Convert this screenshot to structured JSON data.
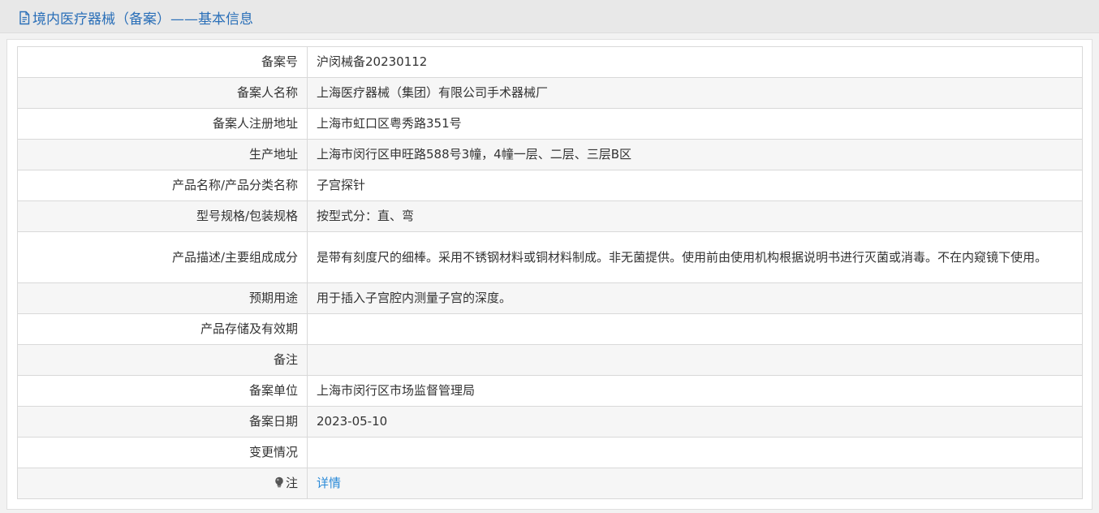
{
  "header": {
    "title": "境内医疗器械（备案）——基本信息",
    "icon": "document-icon"
  },
  "rows": [
    {
      "label": "备案号",
      "value": "沪闵械备20230112"
    },
    {
      "label": "备案人名称",
      "value": "上海医疗器械（集团）有限公司手术器械厂"
    },
    {
      "label": "备案人注册地址",
      "value": "上海市虹口区粤秀路351号"
    },
    {
      "label": "生产地址",
      "value": "上海市闵行区申旺路588号3幢，4幢一层、二层、三层B区"
    },
    {
      "label": "产品名称/产品分类名称",
      "value": "子宫探针"
    },
    {
      "label": "型号规格/包装规格",
      "value": "按型式分：直、弯"
    },
    {
      "label": "产品描述/主要组成成分",
      "value": "是带有刻度尺的细棒。采用不锈钢材料或铜材料制成。非无菌提供。使用前由使用机构根据说明书进行灭菌或消毒。不在内窥镜下使用。"
    },
    {
      "label": "预期用途",
      "value": "用于插入子宫腔内测量子宫的深度。"
    },
    {
      "label": "产品存储及有效期",
      "value": ""
    },
    {
      "label": "备注",
      "value": ""
    },
    {
      "label": "备案单位",
      "value": "上海市闵行区市场监督管理局"
    },
    {
      "label": "备案日期",
      "value": "2023-05-10"
    },
    {
      "label": "变更情况",
      "value": ""
    }
  ],
  "note": {
    "label": "注",
    "icon": "lightbulb-icon",
    "link_text": "详情"
  },
  "colors": {
    "title": "#2a6fb8",
    "link": "#2a8ad8",
    "row_alt": "#f6f6f6",
    "border": "#d9d9d9"
  }
}
